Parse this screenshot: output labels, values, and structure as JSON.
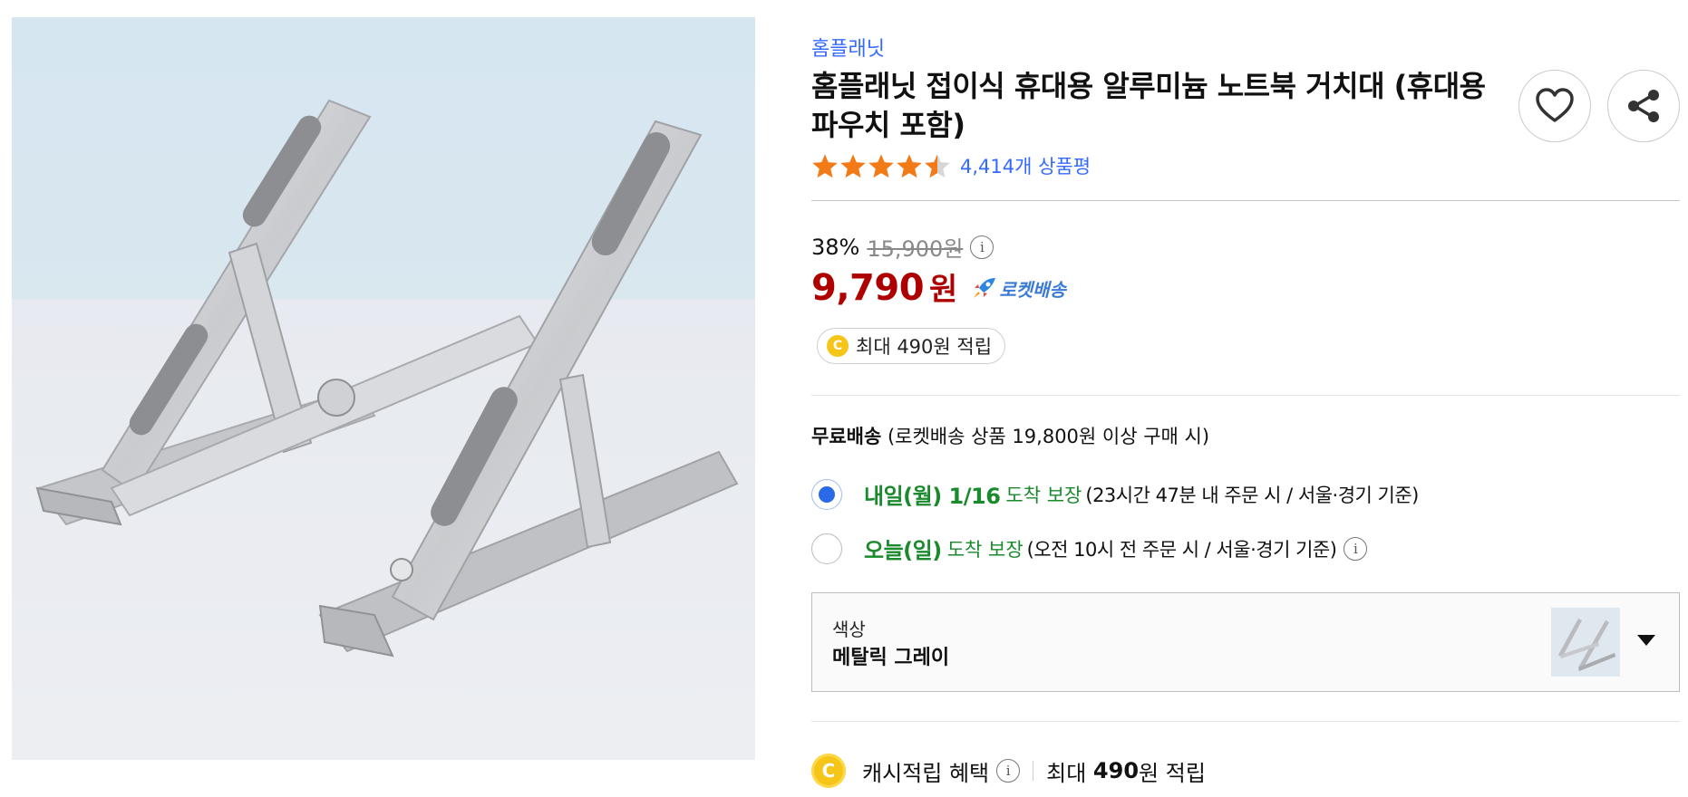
{
  "product": {
    "brand": "홈플래닛",
    "title": "홈플래닛 접이식 휴대용 알루미늄 노트북 거치대 (휴대용 파우치 포함)",
    "rating": 4.5,
    "review_count": "4,414개 상품평"
  },
  "price": {
    "discount": "38%",
    "original": "15,900원",
    "sale": "9,790",
    "currency": "원",
    "delivery_badge": "로켓배송",
    "cash_pill": "최대 490원 적립",
    "coin_letter": "C"
  },
  "shipping": {
    "free_label": "무료배송",
    "free_condition": "(로켓배송 상품 19,800원 이상 구매 시)",
    "options": [
      {
        "day": "내일(월) 1/16",
        "arrive": "도착 보장",
        "condition": "(23시간 47분 내 주문 시 / 서울·경기 기준)",
        "selected": true
      },
      {
        "day": "오늘(일)",
        "arrive": "도착 보장",
        "condition": "(오전 10시 전 주문 시 / 서울·경기 기준)",
        "selected": false
      }
    ]
  },
  "option": {
    "label": "색상",
    "value": "메탈릭 그레이"
  },
  "cash_benefit": {
    "label": "캐시적립 혜택",
    "prefix": "최대",
    "amount": "490",
    "suffix": "원 적립"
  },
  "info_glyph": "i",
  "colors": {
    "accent_blue": "#346aff",
    "price_red": "#ae0000",
    "delivery_green": "#1a8a2d",
    "star_orange": "#f27b17",
    "coin_yellow": "#f5c518"
  },
  "icons": [
    "heart-icon",
    "share-icon",
    "star-icon",
    "info-icon",
    "rocket-icon",
    "coin-icon",
    "chevron-down-icon"
  ]
}
